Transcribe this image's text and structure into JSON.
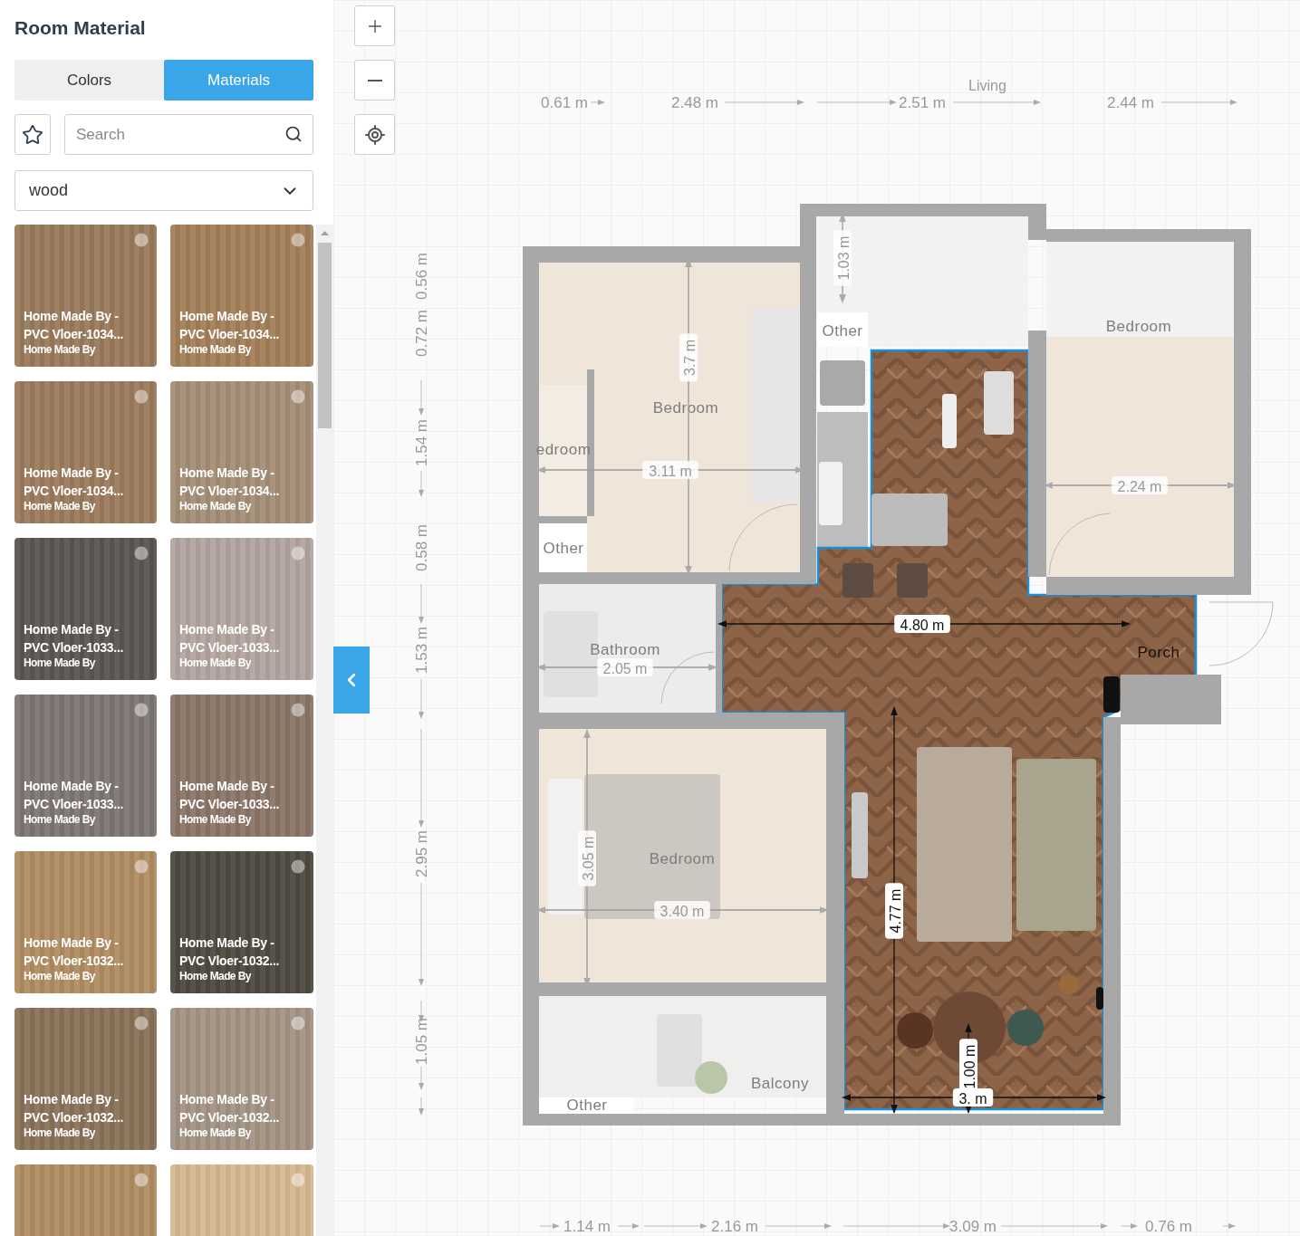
{
  "panel": {
    "title": "Room Material",
    "tabs": [
      {
        "label": "Colors",
        "selected": false
      },
      {
        "label": "Materials",
        "selected": true
      }
    ],
    "search": {
      "placeholder": "Search"
    },
    "filter": {
      "value": "wood"
    },
    "materials": [
      {
        "title": "Home Made By - PVC Vloer-1034...",
        "brand": "Home Made By",
        "color": "#9a7a5c"
      },
      {
        "title": "Home Made By - PVC Vloer-1034...",
        "brand": "Home Made By",
        "color": "#a37f59"
      },
      {
        "title": "Home Made By - PVC Vloer-1034...",
        "brand": "Home Made By",
        "color": "#9c7b5d"
      },
      {
        "title": "Home Made By - PVC Vloer-1034...",
        "brand": "Home Made By",
        "color": "#a48f76"
      },
      {
        "title": "Home Made By - PVC Vloer-1033...",
        "brand": "Home Made By",
        "color": "#5a5652"
      },
      {
        "title": "Home Made By - PVC Vloer-1033...",
        "brand": "Home Made By",
        "color": "#b3a49e"
      },
      {
        "title": "Home Made By - PVC Vloer-1033...",
        "brand": "Home Made By",
        "color": "#7e7674"
      },
      {
        "title": "Home Made By - PVC Vloer-1033...",
        "brand": "Home Made By",
        "color": "#8a7667"
      },
      {
        "title": "Home Made By - PVC Vloer-1032...",
        "brand": "Home Made By",
        "color": "#b08d63"
      },
      {
        "title": "Home Made By - PVC Vloer-1032...",
        "brand": "Home Made By",
        "color": "#4f4a40"
      },
      {
        "title": "Home Made By - PVC Vloer-1032...",
        "brand": "Home Made By",
        "color": "#8a7259"
      },
      {
        "title": "Home Made By - PVC Vloer-1032...",
        "brand": "Home Made By",
        "color": "#a39484"
      },
      {
        "color": "#b08c62"
      },
      {
        "color": "#d6b88f"
      }
    ]
  },
  "plan": {
    "top_label": "Living",
    "top_dimensions": [
      "0.61 m",
      "2.48 m",
      "2.51 m",
      "2.44 m"
    ],
    "bottom_dimensions": [
      "1.14 m",
      "2.16 m",
      "3.09 m",
      "0.76 m"
    ],
    "left_dimensions": [
      "0.56 m",
      "0.72 m",
      "1.54 m",
      "0.58 m",
      "1.53 m",
      "2.95 m",
      "1.05 m"
    ],
    "rooms": [
      {
        "label": "Bedroom",
        "selected": false
      },
      {
        "label": "edroom",
        "selected": false
      },
      {
        "label": "Other",
        "selected": false
      },
      {
        "label": "Bedroom",
        "selected": false
      },
      {
        "label": "Other",
        "selected": false
      },
      {
        "label": "Bathroom",
        "selected": false
      },
      {
        "label": "Porch",
        "selected": true
      },
      {
        "label": "Bedroom",
        "selected": false
      },
      {
        "label": "Balcony",
        "selected": false
      },
      {
        "label": "Other",
        "selected": false
      }
    ],
    "measurements": [
      {
        "label": "3.7 m",
        "kind": "vertical",
        "selected": false
      },
      {
        "label": "3.11 m",
        "kind": "horizontal",
        "selected": false
      },
      {
        "label": "1.03 m",
        "kind": "vertical",
        "selected": false
      },
      {
        "label": "2.24 m",
        "kind": "horizontal",
        "selected": false
      },
      {
        "label": "4.80 m",
        "kind": "horizontal",
        "selected": true
      },
      {
        "label": "2.05 m",
        "kind": "horizontal",
        "selected": false
      },
      {
        "label": "3.05 m",
        "kind": "vertical",
        "selected": false
      },
      {
        "label": "3.40 m",
        "kind": "horizontal",
        "selected": false
      },
      {
        "label": "4.77 m",
        "kind": "vertical",
        "selected": true
      },
      {
        "label": "1.00 m",
        "kind": "vertical",
        "selected": true
      },
      {
        "label": "3. m",
        "kind": "horizontal",
        "selected": true
      }
    ]
  }
}
